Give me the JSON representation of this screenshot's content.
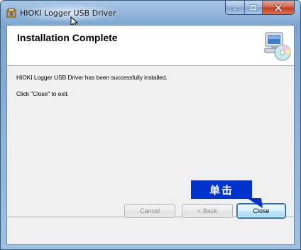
{
  "window": {
    "title": "HIOKI Logger USB Driver",
    "controls": [
      "minimize-icon",
      "maximize-icon",
      "close-icon"
    ]
  },
  "header": {
    "heading": "Installation Complete",
    "art_icon": "computer-disc-icon"
  },
  "body": {
    "line1": "HIOKI Logger USB Driver has been successfully installed.",
    "line2": "Click \"Close\" to exit."
  },
  "buttons": {
    "cancel_label": "Cancel",
    "back_label": "< Back",
    "close_label": "Close"
  },
  "annotation": {
    "label": "单击",
    "color": "#0033cc"
  },
  "colors": {
    "accent_blue": "#3c7fb1",
    "close_red": "#c23b1c"
  }
}
